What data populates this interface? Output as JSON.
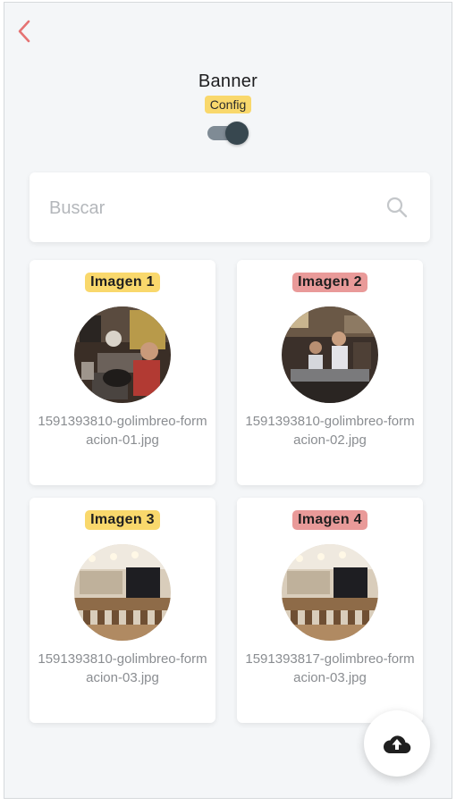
{
  "colors": {
    "accent_red": "#e57373",
    "badge_yellow": "#f9d86c",
    "badge_red": "#e99a99",
    "toggle_thumb": "#37474f",
    "toggle_track": "#7f8b95"
  },
  "header": {
    "back_icon": "chevron-left-icon",
    "title": "Banner",
    "config_label": "Config",
    "toggle_on": true
  },
  "search": {
    "placeholder": "Buscar",
    "value": "",
    "icon": "search-icon"
  },
  "images": [
    {
      "label": "Imagen 1",
      "badge_color": "yellow",
      "filename": "1591393810-golimbreo-formacion-01.jpg"
    },
    {
      "label": "Imagen 2",
      "badge_color": "red",
      "filename": "1591393810-golimbreo-formacion-02.jpg"
    },
    {
      "label": "Imagen 3",
      "badge_color": "yellow",
      "filename": "1591393810-golimbreo-formacion-03.jpg"
    },
    {
      "label": "Imagen 4",
      "badge_color": "red",
      "filename": "1591393817-golimbreo-formacion-03.jpg"
    }
  ],
  "fab": {
    "icon": "cloud-upload-icon"
  }
}
